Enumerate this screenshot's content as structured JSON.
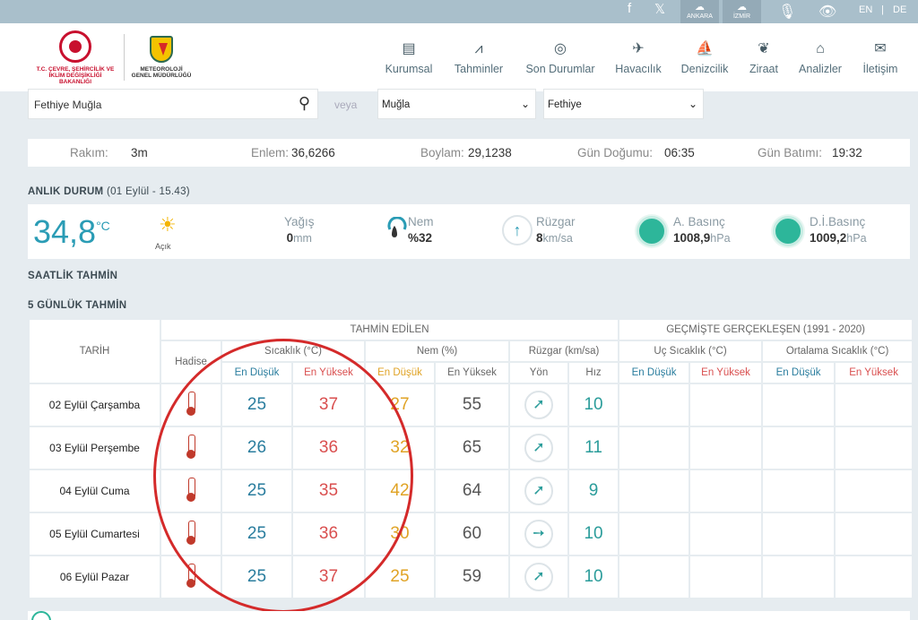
{
  "topbar": {
    "social": [
      "f",
      "𝕏"
    ],
    "cities": [
      "ANKARA",
      "İZMİR"
    ],
    "lang": [
      "EN",
      "|",
      "DE"
    ]
  },
  "header": {
    "ministry": "T.C. ÇEVRE, ŞEHİRCİLİK VE İKLİM DEĞİŞİKLİĞİ BAKANLIĞI",
    "mgm": "METEOROLOJİ GENEL MÜDÜRLÜĞÜ",
    "nav": [
      {
        "label": "Kurumsal",
        "icon": "document-icon"
      },
      {
        "label": "Tahminler",
        "icon": "chart-icon"
      },
      {
        "label": "Son Durumlar",
        "icon": "check-circle-icon"
      },
      {
        "label": "Havacılık",
        "icon": "plane-icon"
      },
      {
        "label": "Denizcilik",
        "icon": "sail-icon"
      },
      {
        "label": "Ziraat",
        "icon": "leaf-icon"
      },
      {
        "label": "Analizler",
        "icon": "analysis-icon"
      },
      {
        "label": "İletişim",
        "icon": "mail-icon"
      }
    ]
  },
  "search": {
    "value": "Fethiye Muğla",
    "or": "veya",
    "province": "Muğla",
    "district": "Fethiye"
  },
  "info": {
    "rakim_label": "Rakım:",
    "rakim": "3m",
    "enlem_label": "Enlem:",
    "enlem": "36,6266",
    "boylam_label": "Boylam:",
    "boylam": "29,1238",
    "sunrise_label": "Gün Doğumu:",
    "sunrise": "06:35",
    "sunset_label": "Gün Batımı:",
    "sunset": "19:32"
  },
  "current": {
    "title": "ANLIK DURUM",
    "subtitle": "(01 Eylül - 15.43)",
    "temp": "34,8",
    "temp_unit": "°C",
    "sky": "Açık",
    "precip_label": "Yağış",
    "precip": "0",
    "precip_unit": "mm",
    "humidity_label": "Nem",
    "humidity": "%32",
    "wind_label": "Rüzgar",
    "wind": "8",
    "wind_unit": "km/sa",
    "pressure_label": "A. Basınç",
    "pressure": "1008,9",
    "pressure_unit": "hPa",
    "sea_pressure_label": "D.İ.Basınç",
    "sea_pressure": "1009,2",
    "sea_pressure_unit": "hPa"
  },
  "hourly_title": "SAATLİK TAHMİN",
  "forecast": {
    "title": "5 GÜNLÜK TAHMİN",
    "headers": {
      "date": "TARİH",
      "predicted": "TAHMİN EDİLEN",
      "history": "GEÇMİŞTE GERÇEKLEŞEN (1991 - 2020)",
      "event": "Hadise",
      "temp": "Sıcaklık (°C)",
      "humidity": "Nem (%)",
      "wind": "Rüzgar (km/sa)",
      "extreme_temp": "Uç Sıcaklık (°C)",
      "avg_temp": "Ortalama Sıcaklık (°C)",
      "low": "En Düşük",
      "high": "En Yüksek",
      "dir": "Yön",
      "speed": "Hız"
    },
    "rows": [
      {
        "date": "02 Eylül Çarşamba",
        "tmin": "25",
        "tmax": "37",
        "hmin": "27",
        "hmax": "55",
        "speed": "10"
      },
      {
        "date": "03 Eylül Perşembe",
        "tmin": "26",
        "tmax": "36",
        "hmin": "32",
        "hmax": "65",
        "speed": "11"
      },
      {
        "date": "04 Eylül Cuma",
        "tmin": "25",
        "tmax": "35",
        "hmin": "42",
        "hmax": "64",
        "speed": "9"
      },
      {
        "date": "05 Eylül Cumartesi",
        "tmin": "25",
        "tmax": "36",
        "hmin": "30",
        "hmax": "60",
        "speed": "10"
      },
      {
        "date": "06 Eylül Pazar",
        "tmin": "25",
        "tmax": "37",
        "hmin": "25",
        "hmax": "59",
        "speed": "10"
      }
    ]
  }
}
